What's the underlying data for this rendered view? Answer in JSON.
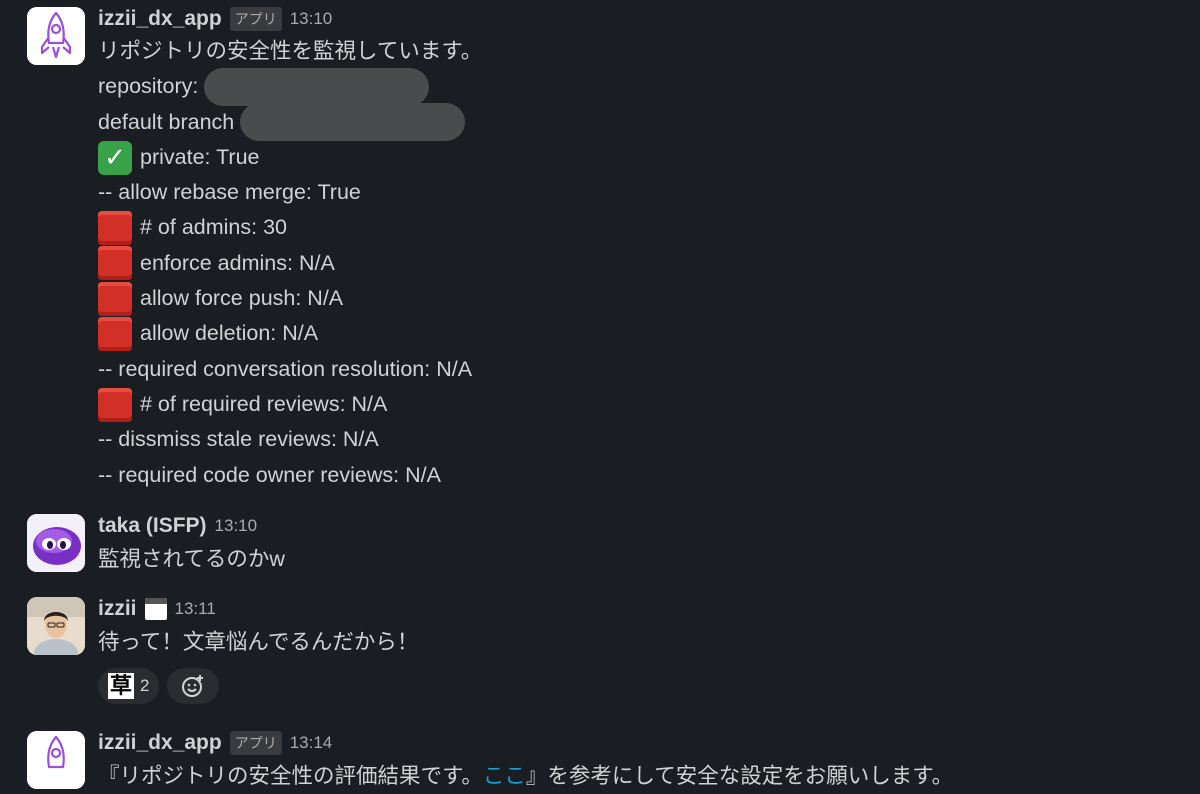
{
  "messages": [
    {
      "author": "izzii_dx_app",
      "app_badge": "アプリ",
      "time": "13:10",
      "lines": {
        "intro": "リポジトリの安全性を監視しています。",
        "repository": "repository:",
        "default_branch": "default branch",
        "private": "private: True",
        "rebase": "-- allow rebase merge: True",
        "admins": "# of admins: 30",
        "enforce": "enforce admins: N/A",
        "force_push": "allow force push: N/A",
        "deletion": "allow deletion: N/A",
        "conv_res": "-- required conversation resolution: N/A",
        "req_reviews": "# of required reviews: N/A",
        "dismiss": "-- dissmiss stale reviews: N/A",
        "code_owner": "-- required code owner reviews: N/A"
      }
    },
    {
      "author": "taka (ISFP)",
      "time": "13:10",
      "text": "監視されてるのかw"
    },
    {
      "author": "izzii",
      "time": "13:11",
      "text": "待って！文章悩んでるんだから！",
      "reaction": {
        "emoji": "草",
        "count": "2"
      }
    },
    {
      "author": "izzii_dx_app",
      "app_badge": "アプリ",
      "time": "13:14",
      "text_prefix": "『リポジトリの安全性の評価結果です。",
      "link_text": "ここ",
      "text_suffix": "』を参考にして安全な設定をお願いします。"
    }
  ],
  "colors": {
    "background": "#1a1d21",
    "text": "#d1d2d3",
    "muted": "#ababad",
    "link": "#1d9bd1",
    "red_square": "#d22f26",
    "check_green": "#3aa14b"
  }
}
